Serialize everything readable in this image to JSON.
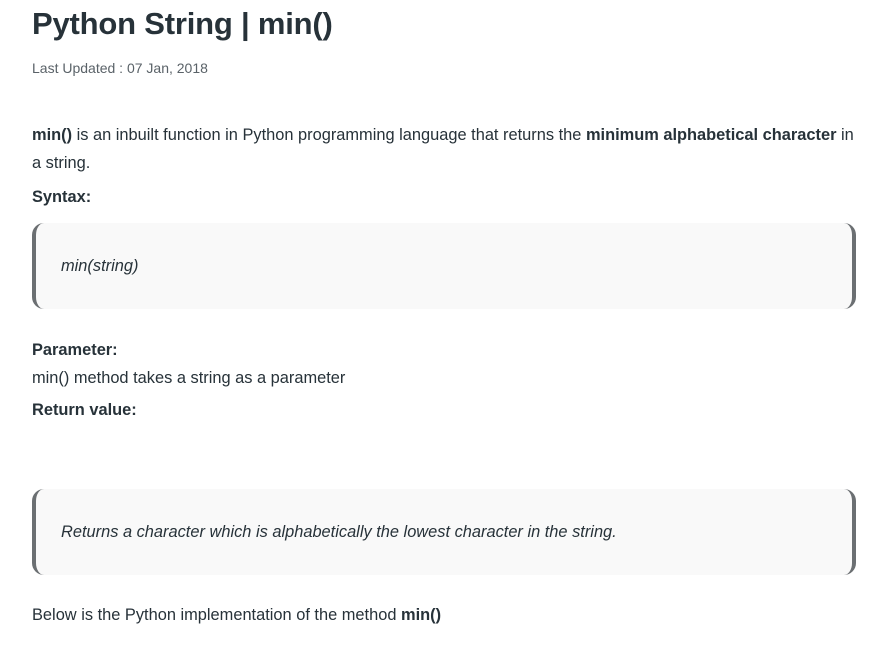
{
  "article": {
    "title": "Python String | min()",
    "last_updated": "Last Updated : 07 Jan, 2018",
    "intro": {
      "fn": "min()",
      "text_a": " is an inbuilt function in Python programming language that returns the ",
      "emph": "minimum alphabetical character",
      "text_b": " in a string."
    },
    "syntax_heading": "Syntax:",
    "syntax_code": "min(string)",
    "parameter_heading": "Parameter:",
    "parameter_text": "min() method takes a string as a parameter",
    "return_heading": "Return value:",
    "return_text": "Returns a character which is alphabetically the lowest character in the string.",
    "impl": {
      "text": "Below is the Python implementation of the method ",
      "fn": "min()"
    }
  }
}
